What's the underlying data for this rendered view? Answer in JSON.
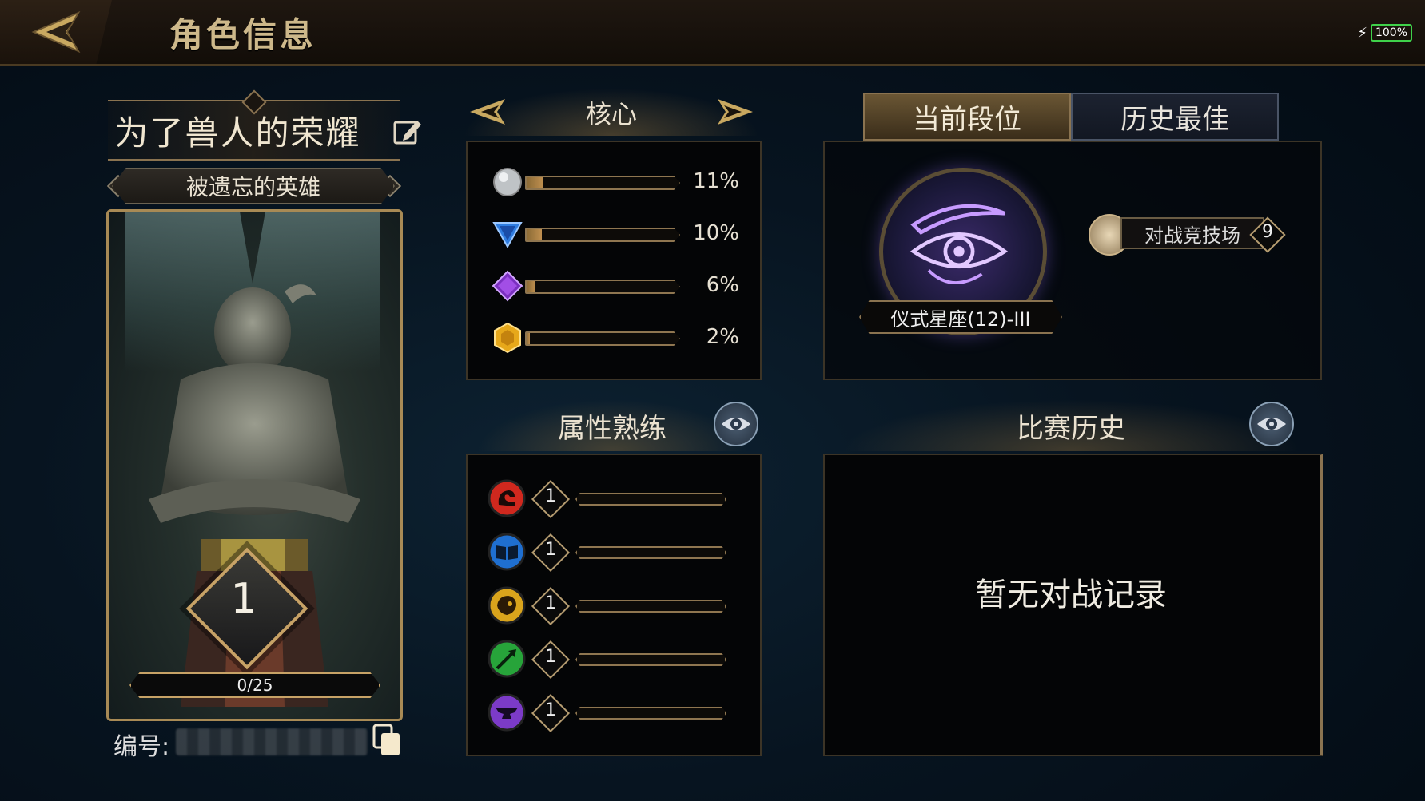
{
  "header": {
    "title": "角色信息",
    "battery": "100%"
  },
  "player": {
    "name": "为了兽人的荣耀",
    "title": "被遗忘的英雄",
    "level": "1",
    "xp": "0/25",
    "id_label": "编号:"
  },
  "core": {
    "title": "核心",
    "stats": [
      {
        "icon": "silver-orb-icon",
        "percent": "11%",
        "fill": 0.11
      },
      {
        "icon": "blue-triangle-icon",
        "percent": "10%",
        "fill": 0.1
      },
      {
        "icon": "purple-diamond-icon",
        "percent": "6%",
        "fill": 0.06
      },
      {
        "icon": "gold-hexagon-icon",
        "percent": "2%",
        "fill": 0.02
      }
    ]
  },
  "proficiency": {
    "title": "属性熟练",
    "items": [
      {
        "icon": "strength-icon",
        "level": "1",
        "color": "#d0281e"
      },
      {
        "icon": "book-icon",
        "level": "1",
        "color": "#1f6fd0"
      },
      {
        "icon": "lion-icon",
        "level": "1",
        "color": "#d9a41c"
      },
      {
        "icon": "arrow-icon",
        "level": "1",
        "color": "#27a43a"
      },
      {
        "icon": "anvil-icon",
        "level": "1",
        "color": "#7c3bc8"
      }
    ]
  },
  "rank": {
    "tab_current": "当前段位",
    "tab_best": "历史最佳",
    "rank_name": "仪式星座(12)-III",
    "arena_label": "对战竞技场",
    "arena_count": "9"
  },
  "history": {
    "title": "比赛历史",
    "empty_text": "暂无对战记录"
  }
}
